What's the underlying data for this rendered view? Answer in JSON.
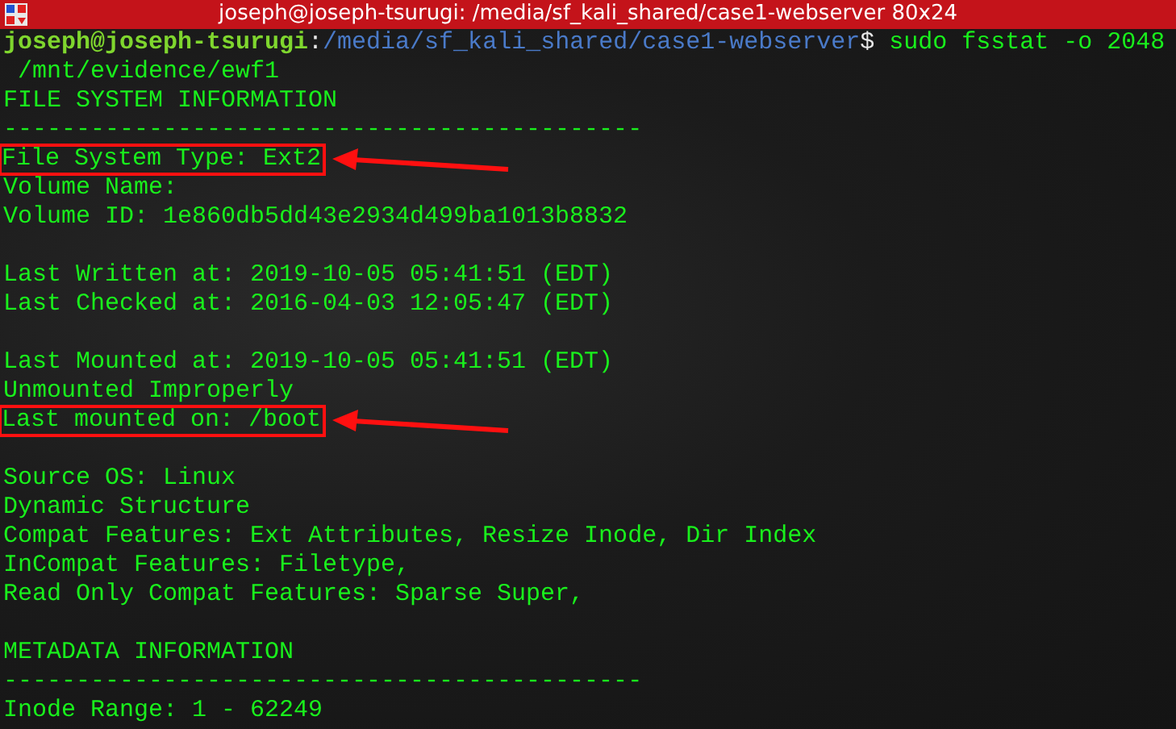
{
  "window": {
    "title": "joseph@joseph-tsurugi: /media/sf_kali_shared/case1-webserver 80x24"
  },
  "prompt": {
    "user": "joseph@joseph-tsurugi",
    "separator": ":",
    "path": "/media/sf_kali_shared/case1-webserver",
    "symbol": "$",
    "command": "sudo fsstat -o 2048"
  },
  "lines": [
    {
      "kind": "text",
      "text": " /mnt/evidence/ewf1",
      "highlighted": false
    },
    {
      "kind": "text",
      "text": "FILE SYSTEM INFORMATION",
      "highlighted": false
    },
    {
      "kind": "text",
      "text": "--------------------------------------------",
      "highlighted": false
    },
    {
      "kind": "text",
      "text": "File System Type: Ext2",
      "highlighted": true
    },
    {
      "kind": "text",
      "text": "Volume Name:",
      "highlighted": false
    },
    {
      "kind": "text",
      "text": "Volume ID: 1e860db5dd43e2934d499ba1013b8832",
      "highlighted": false
    },
    {
      "kind": "blank"
    },
    {
      "kind": "text",
      "text": "Last Written at: 2019-10-05 05:41:51 (EDT)",
      "highlighted": false
    },
    {
      "kind": "text",
      "text": "Last Checked at: 2016-04-03 12:05:47 (EDT)",
      "highlighted": false
    },
    {
      "kind": "blank"
    },
    {
      "kind": "text",
      "text": "Last Mounted at: 2019-10-05 05:41:51 (EDT)",
      "highlighted": false
    },
    {
      "kind": "text",
      "text": "Unmounted Improperly",
      "highlighted": false
    },
    {
      "kind": "text",
      "text": "Last mounted on: /boot",
      "highlighted": true
    },
    {
      "kind": "blank"
    },
    {
      "kind": "text",
      "text": "Source OS: Linux",
      "highlighted": false
    },
    {
      "kind": "text",
      "text": "Dynamic Structure",
      "highlighted": false
    },
    {
      "kind": "text",
      "text": "Compat Features: Ext Attributes, Resize Inode, Dir Index",
      "highlighted": false
    },
    {
      "kind": "text",
      "text": "InCompat Features: Filetype,",
      "highlighted": false
    },
    {
      "kind": "text",
      "text": "Read Only Compat Features: Sparse Super,",
      "highlighted": false
    },
    {
      "kind": "blank"
    },
    {
      "kind": "text",
      "text": "METADATA INFORMATION",
      "highlighted": false
    },
    {
      "kind": "text",
      "text": "--------------------------------------------",
      "highlighted": false
    },
    {
      "kind": "text",
      "text": "Inode Range: 1 - 62249",
      "highlighted": false
    }
  ]
}
